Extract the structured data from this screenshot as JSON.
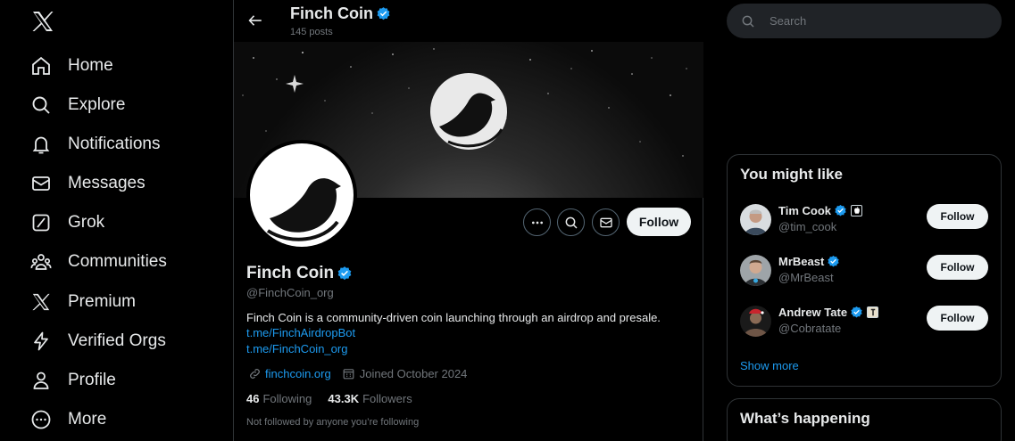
{
  "colors": {
    "accent": "#1d9bf0",
    "background": "#000000",
    "muted": "#71767b",
    "text": "#e7e9ea"
  },
  "nav": {
    "items": [
      {
        "label": "Home",
        "icon": "home-icon"
      },
      {
        "label": "Explore",
        "icon": "search-icon"
      },
      {
        "label": "Notifications",
        "icon": "bell-icon"
      },
      {
        "label": "Messages",
        "icon": "mail-icon"
      },
      {
        "label": "Grok",
        "icon": "grok-icon"
      },
      {
        "label": "Communities",
        "icon": "people-icon"
      },
      {
        "label": "Premium",
        "icon": "x-logo-icon"
      },
      {
        "label": "Verified Orgs",
        "icon": "lightning-icon"
      },
      {
        "label": "Profile",
        "icon": "person-icon"
      },
      {
        "label": "More",
        "icon": "more-circle-icon"
      }
    ]
  },
  "header": {
    "name": "Finch Coin",
    "posts": "145 posts"
  },
  "profile": {
    "name": "Finch Coin",
    "handle": "@FinchCoin_org",
    "bio": "Finch Coin is a community-driven coin launching through an airdrop and presale.",
    "links": [
      "t.me/FinchAirdropBot",
      "t.me/FinchCoin_org"
    ],
    "website": "finchcoin.org",
    "joined": "Joined October 2024",
    "following_count": "46",
    "following_label": "Following",
    "followers_count": "43.3K",
    "followers_label": "Followers",
    "note": "Not followed by anyone you’re following",
    "follow_label": "Follow"
  },
  "search": {
    "placeholder": "Search"
  },
  "suggestions": {
    "title": "You might like",
    "items": [
      {
        "name": "Tim Cook",
        "handle": "@tim_cook",
        "follow": "Follow",
        "badge": "apple-badge-icon"
      },
      {
        "name": "MrBeast",
        "handle": "@MrBeast",
        "follow": "Follow",
        "badge": ""
      },
      {
        "name": "Andrew Tate",
        "handle": "@Cobratate",
        "follow": "Follow",
        "badge": "org-badge-icon"
      }
    ],
    "show_more": "Show more"
  },
  "happening": {
    "title": "What’s happening"
  }
}
